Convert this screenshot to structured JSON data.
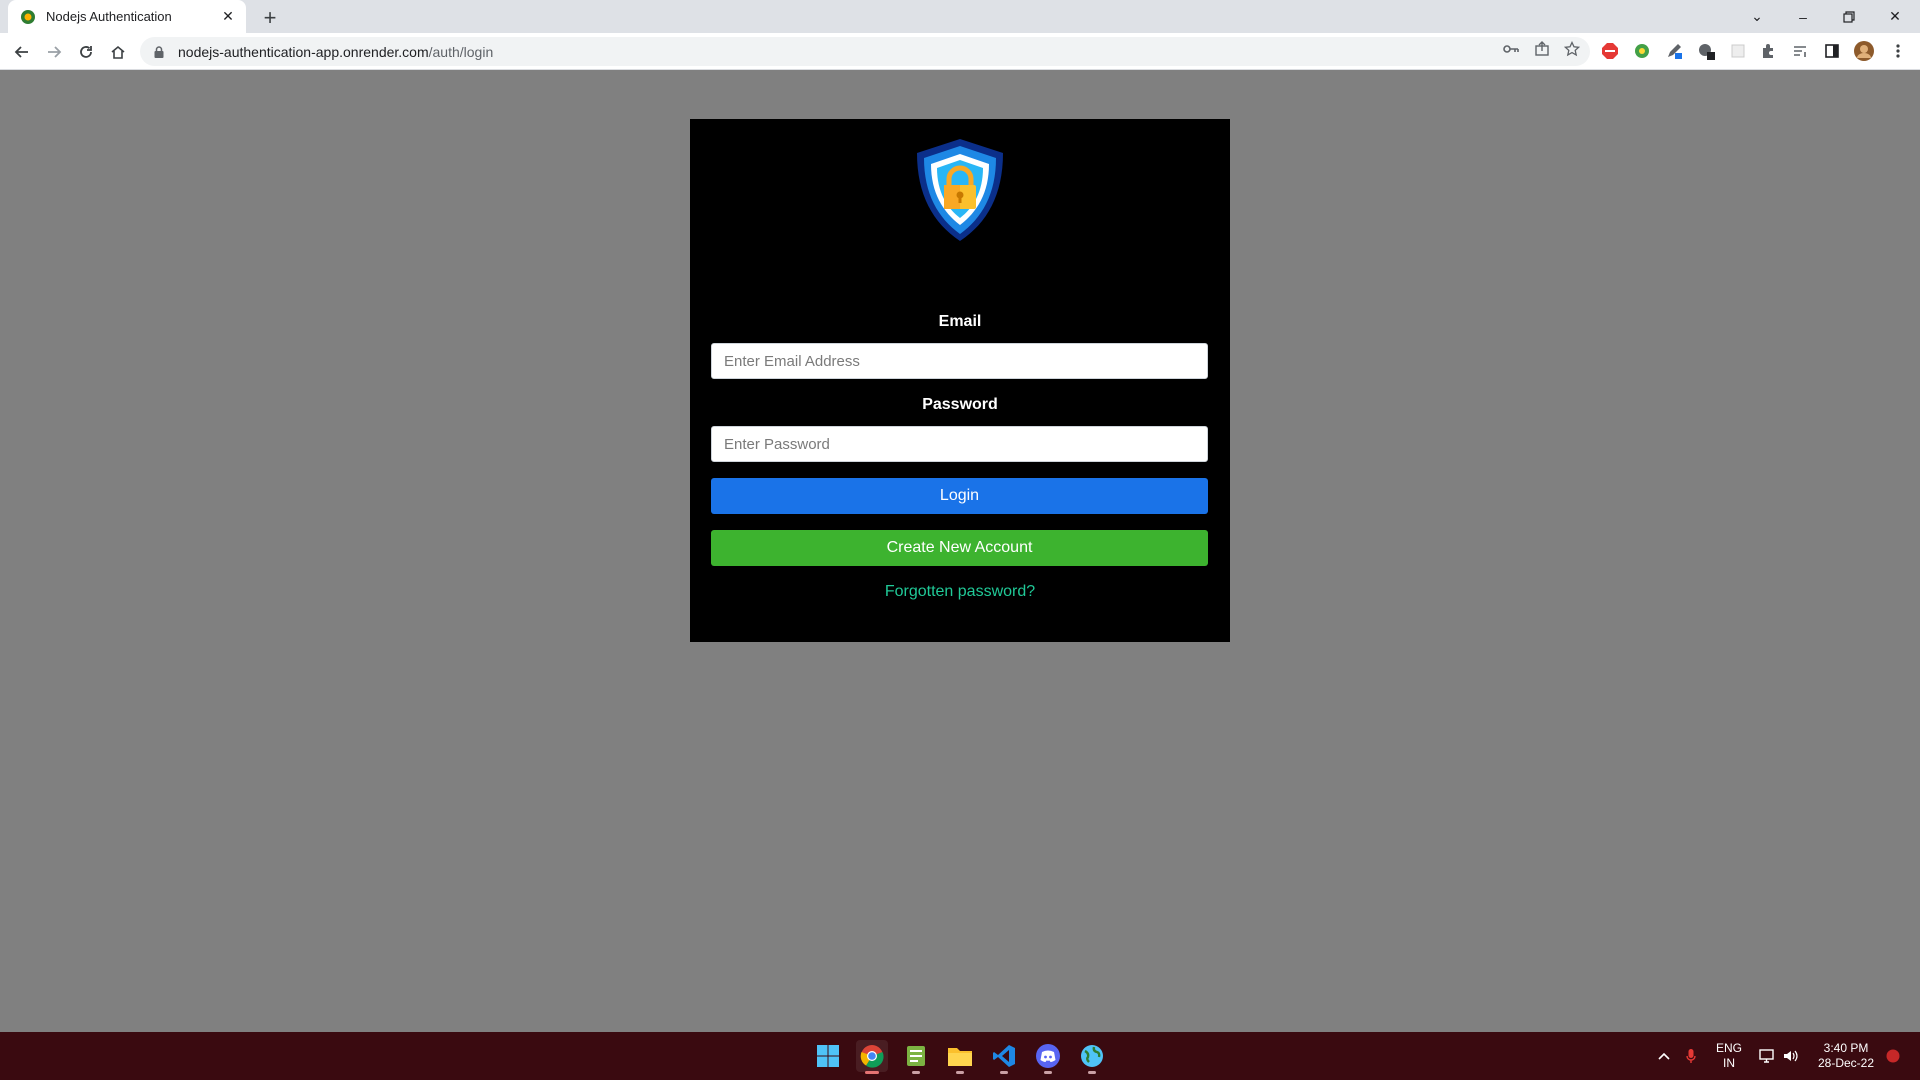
{
  "browser": {
    "tab_title": "Nodejs Authentication",
    "url_host": "nodejs-authentication-app.onrender.com",
    "url_path": "/auth/login"
  },
  "login": {
    "email_label": "Email",
    "email_placeholder": "Enter Email Address",
    "password_label": "Password",
    "password_placeholder": "Enter Password",
    "login_button": "Login",
    "create_account_button": "Create New Account",
    "forgot_link": "Forgotten password?"
  },
  "taskbar": {
    "lang_line1": "ENG",
    "lang_line2": "IN",
    "time": "3:40 PM",
    "date": "28-Dec-22"
  },
  "colors": {
    "page_bg": "#808080",
    "card_bg": "#000000",
    "login_button": "#1a73e8",
    "create_button": "#3db32f",
    "link": "#20c997",
    "taskbar_bg": "#3a0a10"
  },
  "icons": [
    "shield-lock-logo",
    "back-icon",
    "forward-icon",
    "reload-icon",
    "home-icon",
    "lock-icon",
    "key-icon",
    "share-icon",
    "star-icon",
    "extensions-icon",
    "sidepanel-icon",
    "profile-avatar",
    "windows-start-icon",
    "chrome-icon",
    "files-icon",
    "vscode-icon",
    "discord-icon"
  ]
}
